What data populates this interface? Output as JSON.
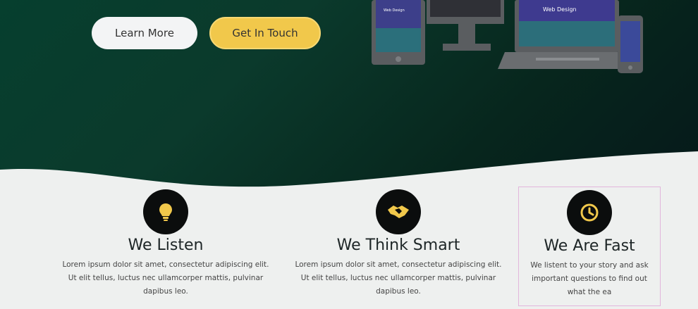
{
  "hero": {
    "buttons": {
      "learn_more": "Learn More",
      "get_in_touch": "Get In Touch"
    },
    "device_mockup": {
      "screen_title": "Web Design",
      "tablet_title": "Web Design"
    }
  },
  "features": [
    {
      "icon": "lightbulb-icon",
      "title": "We Listen",
      "text": "Lorem ipsum dolor sit amet, consectetur adipiscing elit. Ut elit tellus, luctus nec ullamcorper mattis, pulvinar dapibus leo."
    },
    {
      "icon": "handshake-icon",
      "title": "We Think Smart",
      "text": "Lorem ipsum dolor sit amet, consectetur adipiscing elit. Ut elit tellus, luctus nec ullamcorper mattis, pulvinar dapibus leo."
    },
    {
      "icon": "clock-icon",
      "title": "We Are Fast",
      "text": "We listent to your story and ask important questions to find out what the ea"
    }
  ],
  "colors": {
    "hero_bg": "#063f2e",
    "accent_yellow": "#f1c84b",
    "icon_circle": "#0b0d0d"
  }
}
